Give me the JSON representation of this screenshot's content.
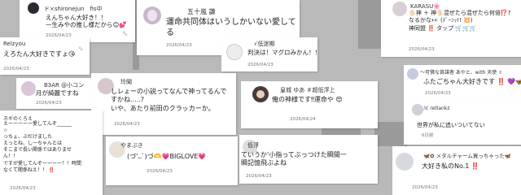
{
  "colors": {
    "background": "#b9b9b9",
    "card": "#ffffff",
    "heart": "#e23c6a",
    "date": "#777777",
    "icon": "#b7b7b7"
  },
  "cards": {
    "c1": {
      "name": "ド×shironejun　fis中",
      "lines": [
        "えんちゃん大好き！！",
        "一生みやの推し様だから😊💕"
      ],
      "date": "2026/04/23"
    },
    "c2": {
      "name": "五十嵐 謙",
      "lines": [
        "運命共同体はいうしかいない愛してる"
      ],
      "date": "2026/04/23"
    },
    "c3": {
      "name": "KARASU🌸",
      "lines": [
        "🖐🏻神 ＋ 神🖐🏻混ぜたら混ぜたら何倍⁉️?",
        "なるかな👀 (ﾃﾞｰﾝｯ!! 💥)",
        "神同盟 ‼️ タップ 🛒🛒🛒"
      ],
      "date": "2026/04/23"
    },
    "c4": {
      "name": "Relzyou",
      "lines": [
        "えろたん大好きですょ😘"
      ],
      "date": "2026/04/23"
    },
    "c5": {
      "name": "√低迷期",
      "lines": [
        "判決は！マグロみかん！！！！！！！"
      ],
      "date": "2026/04/23"
    },
    "c6": {
      "name": "～可憐な首謀者 あやと、with 天使 ✌",
      "lines": [
        "ふたごちゃん大好きです ‼️ 💜🦋 🌙"
      ],
      "date": "2026/04/23"
    },
    "c7": {
      "name": "B3AR @小コン",
      "lines": [
        "月が綺麗ですね"
      ],
      "date": "2026/04/23"
    },
    "c8": {
      "name": "玲聞",
      "lines": [
        "しレょーの小説ってなんで神ってるんですかね.....?",
        "いや、あたり前田のクラッカーか。"
      ],
      "date": "2026/04/23"
    },
    "c9": {
      "name": "皇城 ゆあ ＃超低浮上",
      "lines": [
        "俺の神様です‼︎運命や 😍"
      ],
      "date": "2026/04/24"
    },
    "c10": {
      "name": "ℳ retlankz",
      "lines": [
        "世界が私に追いついてない"
      ],
      "date": "6日前"
    },
    "c11": {
      "name": "ネギのくろえ",
      "lines": [
        "えーーーーー愛してんぞ______",
        "☆",
        "っちょ、ぶだけました",
        "えっとね、しーちゃんとは",
        "そこまで長い関係ではありませ",
        "ん！！",
        "ですが愛してんぞーーーー！！時間",
        "なくて閲係ねえ！！ ‼️"
      ],
      "date": "2026/04/23"
    },
    "c12": {
      "name": "やまぶき",
      "lines": [
        "(づ'᎑`)づ🫶💗BIGLOVE💗"
      ],
      "date": "2026/04/23"
    },
    "c13": {
      "name": "低浮",
      "lines": [
        "ていうか'小指ってぶっつけた瞬間一",
        "瞬記憶飛ぶよね"
      ],
      "date": "2026/04/23"
    },
    "c14": {
      "name": "🦋✿ メタルチャーム買っちゃった🦋",
      "lines": [
        "大好き私のNo.1 ‼️"
      ],
      "date": "2026/04/23"
    }
  }
}
